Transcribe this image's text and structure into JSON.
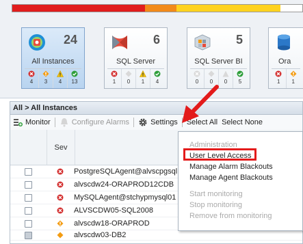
{
  "colors": {
    "severity_strip": [
      "#e11d1d",
      "#f28a1a",
      "#ffd21f",
      "#ffffff"
    ],
    "accent": "#2b6cb0",
    "critical": "#d32f2f",
    "warning": "#f39c12",
    "info": "#f1c40f",
    "ok": "#2e9e3a",
    "callout": "#e31b1b"
  },
  "tiles": [
    {
      "count": "24",
      "name": "All Instances",
      "stats": [
        "4",
        "3",
        "4",
        "13"
      ],
      "icon": "all-instances-icon"
    },
    {
      "count": "6",
      "name": "SQL Server",
      "stats": [
        "1",
        "0",
        "1",
        "4"
      ],
      "icon": "sql-server-icon"
    },
    {
      "count": "5",
      "name": "SQL Server BI",
      "stats": [
        "0",
        "0",
        "0",
        "5"
      ],
      "icon": "sql-server-bi-icon"
    },
    {
      "count": "",
      "name": "Ora",
      "stats": [
        "1",
        "1",
        "",
        ""
      ],
      "icon": "oracle-icon"
    }
  ],
  "panel": {
    "breadcrumb": "All > All Instances",
    "toolbar": {
      "monitor": "Monitor",
      "configure_alarms": "Configure Alarms",
      "settings": "Settings",
      "select_all": "Select All",
      "select_none": "Select None"
    },
    "columns": {
      "severity": "Sev"
    },
    "rows": [
      {
        "name": "PostgreSQLAgent@alvscpgsql",
        "severity": "critical"
      },
      {
        "name": "alvscdw24-ORAPROD12CDB",
        "severity": "critical"
      },
      {
        "name": "MySQLAgent@stchypmysql01",
        "severity": "critical"
      },
      {
        "name": "ALVSCDW05-SQL2008",
        "severity": "critical"
      },
      {
        "name": "alvscdw18-ORAPROD",
        "severity": "warning"
      },
      {
        "name": "alvscdw03-DB2",
        "severity": "warning"
      }
    ]
  },
  "settings_menu": {
    "administration": "Administration",
    "user_level_access": "User Level Access",
    "manage_alarm_blackouts": "Manage Alarm Blackouts",
    "manage_agent_blackouts": "Manage Agent Blackouts",
    "start_monitoring": "Start monitoring",
    "stop_monitoring": "Stop monitoring",
    "remove_from_monitoring": "Remove from monitoring"
  }
}
